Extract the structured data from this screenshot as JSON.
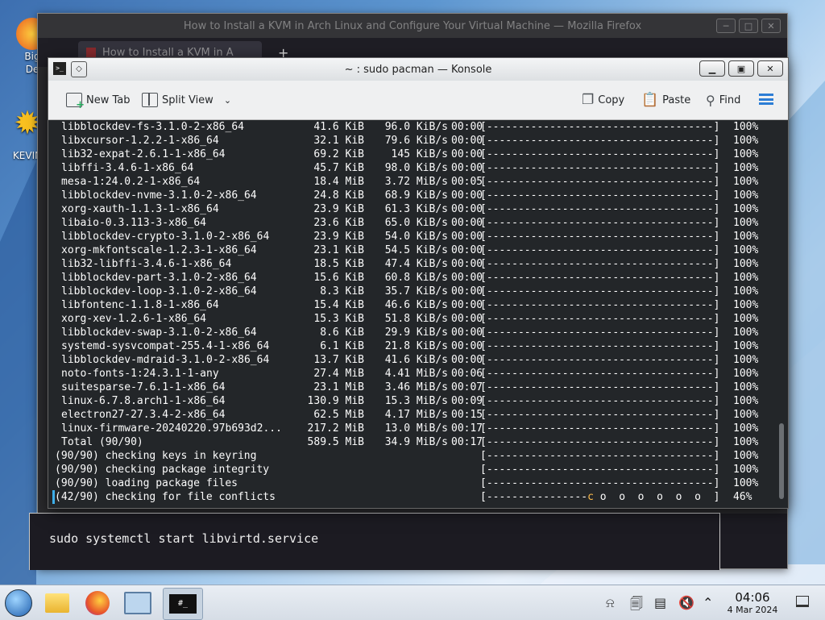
{
  "desktop": {
    "icons": [
      {
        "label": "Big\nDe",
        "name": "desktop-icon-bigde"
      },
      {
        "label": "KEVIN",
        "name": "desktop-icon-kevin"
      }
    ]
  },
  "firefox": {
    "title": "How to Install a KVM in Arch Linux and Configure Your Virtual Machine — Mozilla Firefox",
    "tab_label": "How to Install a KVM in A",
    "new_tab": "+",
    "code_text": "sudo systemctl start libvirtd.service"
  },
  "konsole": {
    "title": "~ : sudo pacman — Konsole",
    "toolbar": {
      "new_tab": "New Tab",
      "split_view": "Split View",
      "copy": "Copy",
      "paste": "Paste",
      "find": "Find"
    },
    "packages": [
      {
        "name": "libblockdev-fs-3.1.0-2-x86_64",
        "size": "41.6 KiB",
        "rate": "96.0 KiB/s",
        "time": "00:00",
        "pct": "100%"
      },
      {
        "name": "libxcursor-1.2.2-1-x86_64",
        "size": "32.1 KiB",
        "rate": "79.6 KiB/s",
        "time": "00:00",
        "pct": "100%"
      },
      {
        "name": "lib32-expat-2.6.1-1-x86_64",
        "size": "69.2 KiB",
        "rate": "145 KiB/s",
        "time": "00:00",
        "pct": "100%"
      },
      {
        "name": "libffi-3.4.6-1-x86_64",
        "size": "45.7 KiB",
        "rate": "98.0 KiB/s",
        "time": "00:00",
        "pct": "100%"
      },
      {
        "name": "mesa-1:24.0.2-1-x86_64",
        "size": "18.4 MiB",
        "rate": "3.72 MiB/s",
        "time": "00:05",
        "pct": "100%"
      },
      {
        "name": "libblockdev-nvme-3.1.0-2-x86_64",
        "size": "24.8 KiB",
        "rate": "68.9 KiB/s",
        "time": "00:00",
        "pct": "100%"
      },
      {
        "name": "xorg-xauth-1.1.3-1-x86_64",
        "size": "23.9 KiB",
        "rate": "61.3 KiB/s",
        "time": "00:00",
        "pct": "100%"
      },
      {
        "name": "libaio-0.3.113-3-x86_64",
        "size": "23.6 KiB",
        "rate": "65.0 KiB/s",
        "time": "00:00",
        "pct": "100%"
      },
      {
        "name": "libblockdev-crypto-3.1.0-2-x86_64",
        "size": "23.9 KiB",
        "rate": "54.0 KiB/s",
        "time": "00:00",
        "pct": "100%"
      },
      {
        "name": "xorg-mkfontscale-1.2.3-1-x86_64",
        "size": "23.1 KiB",
        "rate": "54.5 KiB/s",
        "time": "00:00",
        "pct": "100%"
      },
      {
        "name": "lib32-libffi-3.4.6-1-x86_64",
        "size": "18.5 KiB",
        "rate": "47.4 KiB/s",
        "time": "00:00",
        "pct": "100%"
      },
      {
        "name": "libblockdev-part-3.1.0-2-x86_64",
        "size": "15.6 KiB",
        "rate": "60.8 KiB/s",
        "time": "00:00",
        "pct": "100%"
      },
      {
        "name": "libblockdev-loop-3.1.0-2-x86_64",
        "size": "8.3 KiB",
        "rate": "35.7 KiB/s",
        "time": "00:00",
        "pct": "100%"
      },
      {
        "name": "libfontenc-1.1.8-1-x86_64",
        "size": "15.4 KiB",
        "rate": "46.6 KiB/s",
        "time": "00:00",
        "pct": "100%"
      },
      {
        "name": "xorg-xev-1.2.6-1-x86_64",
        "size": "15.3 KiB",
        "rate": "51.8 KiB/s",
        "time": "00:00",
        "pct": "100%"
      },
      {
        "name": "libblockdev-swap-3.1.0-2-x86_64",
        "size": "8.6 KiB",
        "rate": "29.9 KiB/s",
        "time": "00:00",
        "pct": "100%"
      },
      {
        "name": "systemd-sysvcompat-255.4-1-x86_64",
        "size": "6.1 KiB",
        "rate": "21.8 KiB/s",
        "time": "00:00",
        "pct": "100%"
      },
      {
        "name": "libblockdev-mdraid-3.1.0-2-x86_64",
        "size": "13.7 KiB",
        "rate": "41.6 KiB/s",
        "time": "00:00",
        "pct": "100%"
      },
      {
        "name": "noto-fonts-1:24.3.1-1-any",
        "size": "27.4 MiB",
        "rate": "4.41 MiB/s",
        "time": "00:06",
        "pct": "100%"
      },
      {
        "name": "suitesparse-7.6.1-1-x86_64",
        "size": "23.1 MiB",
        "rate": "3.46 MiB/s",
        "time": "00:07",
        "pct": "100%"
      },
      {
        "name": "linux-6.7.8.arch1-1-x86_64",
        "size": "130.9 MiB",
        "rate": "15.3 MiB/s",
        "time": "00:09",
        "pct": "100%"
      },
      {
        "name": "electron27-27.3.4-2-x86_64",
        "size": "62.5 MiB",
        "rate": "4.17 MiB/s",
        "time": "00:15",
        "pct": "100%"
      },
      {
        "name": "linux-firmware-20240220.97b693d2...",
        "size": "217.2 MiB",
        "rate": "13.0 MiB/s",
        "time": "00:17",
        "pct": "100%"
      },
      {
        "name": "Total (90/90)",
        "size": "589.5 MiB",
        "rate": "34.9 MiB/s",
        "time": "00:17",
        "pct": "100%"
      }
    ],
    "full_bar": "[------------------------------------]",
    "steps": [
      {
        "text": "(90/90) checking keys in keyring",
        "pct": "100%"
      },
      {
        "text": "(90/90) checking package integrity",
        "pct": "100%"
      },
      {
        "text": "(90/90) loading package files",
        "pct": "100%"
      }
    ],
    "current_step": {
      "text": "(42/90) checking for file conflicts",
      "bar_done": "[----------------",
      "pacman": "c",
      "bar_rest": " o  o  o  o  o  o  ]",
      "pct": "46%"
    }
  },
  "taskbar": {
    "time": "04:06",
    "date": "4 Mar 2024",
    "konsole_glyph": "#_"
  },
  "colors": {
    "terminal_bg": "#232629",
    "terminal_fg": "#fcfcfc",
    "pacman": "#fdbc4b",
    "accent": "#3daee9"
  }
}
